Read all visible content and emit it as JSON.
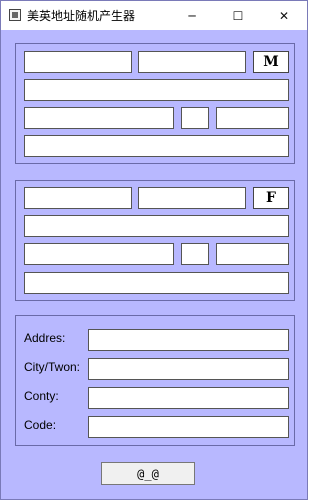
{
  "window": {
    "title": "美英地址随机产生器",
    "controls": {
      "minimize": "─",
      "maximize": "☐",
      "close": "✕"
    }
  },
  "male_group": {
    "gender_button": "M"
  },
  "female_group": {
    "gender_button": "F"
  },
  "address_form": {
    "address_label": "Addres:",
    "city_label": "City/Twon:",
    "county_label": "Conty:",
    "code_label": "Code:"
  },
  "generate_button": {
    "label": "@_@"
  }
}
